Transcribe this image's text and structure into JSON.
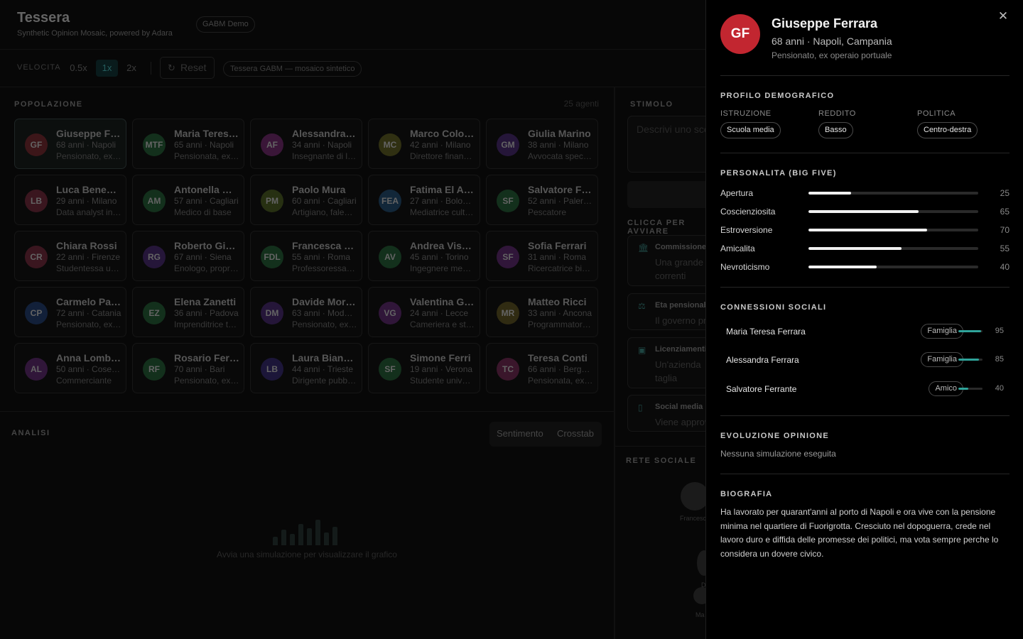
{
  "header": {
    "title": "Tessera",
    "subtitle": "Synthetic Opinion Mosaic, powered by Adara",
    "badge": "GABM Demo"
  },
  "toolbar": {
    "speed_label": "VELOCITA",
    "speeds": [
      "0.5x",
      "1x",
      "2x"
    ],
    "active_speed": "1x",
    "reset_icon": "refresh-icon",
    "reset_label": "Reset",
    "sim_badge": "Tessera GABM — mosaico sintetico"
  },
  "population": {
    "label": "POPOLAZIONE",
    "count": "25 agenti",
    "agents": [
      {
        "initials": "GF",
        "name": "Giuseppe Ferrara",
        "meta": "68 anni · Napoli",
        "job": "Pensionato, ex operaio portuale",
        "color": "#5c2327",
        "selected": true
      },
      {
        "initials": "MTF",
        "name": "Maria Teresa Ferrara",
        "meta": "65 anni · Napoli",
        "job": "Pensionata, ex insegnante",
        "color": "#1e4a2c"
      },
      {
        "initials": "AF",
        "name": "Alessandra Ferrara",
        "meta": "34 anni · Napoli",
        "job": "Insegnante di liceo",
        "color": "#5a2356"
      },
      {
        "initials": "MC",
        "name": "Marco Colombo",
        "meta": "42 anni · Milano",
        "job": "Direttore finanziario",
        "color": "#4a4a1c"
      },
      {
        "initials": "GM",
        "name": "Giulia Marino",
        "meta": "38 anni · Milano",
        "job": "Avvocata specializzata",
        "color": "#3a2358"
      },
      {
        "initials": "LB",
        "name": "Luca Benedetti",
        "meta": "29 anni · Milano",
        "job": "Data analyst in startup",
        "color": "#5a2330"
      },
      {
        "initials": "AM",
        "name": "Antonella Melis",
        "meta": "57 anni · Cagliari",
        "job": "Medico di base",
        "color": "#1e4a2c"
      },
      {
        "initials": "PM",
        "name": "Paolo Mura",
        "meta": "60 anni · Cagliari",
        "job": "Artigiano, falegname",
        "color": "#3c4a1c"
      },
      {
        "initials": "FEA",
        "name": "Fatima El Amrani",
        "meta": "27 anni · Bologna",
        "job": "Mediatrice culturale",
        "color": "#1c3c58"
      },
      {
        "initials": "SF",
        "name": "Salvatore Ferrante",
        "meta": "52 anni · Palermo",
        "job": "Pescatore",
        "color": "#1e4a2c"
      },
      {
        "initials": "CR",
        "name": "Chiara Rossi",
        "meta": "22 anni · Firenze",
        "job": "Studentessa universitaria",
        "color": "#5a2330"
      },
      {
        "initials": "RG",
        "name": "Roberto Giannini",
        "meta": "67 anni · Siena",
        "job": "Enologo, proprietario",
        "color": "#3a2358"
      },
      {
        "initials": "FDL",
        "name": "Francesca De Luca",
        "meta": "55 anni · Roma",
        "job": "Professoressa universitaria",
        "color": "#1e4a2c"
      },
      {
        "initials": "AV",
        "name": "Andrea Visconti",
        "meta": "45 anni · Torino",
        "job": "Ingegnere meccanico",
        "color": "#1e4a2c"
      },
      {
        "initials": "SF",
        "name": "Sofia Ferrari",
        "meta": "31 anni · Roma",
        "job": "Ricercatrice biomedica",
        "color": "#4a2358"
      },
      {
        "initials": "CP",
        "name": "Carmelo Pappalardo",
        "meta": "72 anni · Catania",
        "job": "Pensionato, ex agricoltore",
        "color": "#1c3258"
      },
      {
        "initials": "EZ",
        "name": "Elena Zanetti",
        "meta": "36 anni · Padova",
        "job": "Imprenditrice tessile",
        "color": "#1e4a2c"
      },
      {
        "initials": "DM",
        "name": "Davide Moretti",
        "meta": "63 anni · Modena",
        "job": "Pensionato, ex operaio",
        "color": "#3a2358"
      },
      {
        "initials": "VG",
        "name": "Valentina Greco",
        "meta": "24 anni · Lecce",
        "job": "Cameriera e studentessa",
        "color": "#4a2358"
      },
      {
        "initials": "MR",
        "name": "Matteo Ricci",
        "meta": "33 anni · Ancona",
        "job": "Programmatore freelance",
        "color": "#4a421c"
      },
      {
        "initials": "AL",
        "name": "Anna Lombardi",
        "meta": "50 anni · Cosenza",
        "job": "Commerciante",
        "color": "#4a2358"
      },
      {
        "initials": "RF",
        "name": "Rosario Ferraro",
        "meta": "70 anni · Bari",
        "job": "Pensionato, ex muratore",
        "color": "#1e4a2c"
      },
      {
        "initials": "LB",
        "name": "Laura Bianchi",
        "meta": "44 anni · Trieste",
        "job": "Dirigente pubblica",
        "color": "#2c2358"
      },
      {
        "initials": "SF",
        "name": "Simone Ferri",
        "meta": "19 anni · Verona",
        "job": "Studente universitario",
        "color": "#1e4a2c"
      },
      {
        "initials": "TC",
        "name": "Teresa Conti",
        "meta": "66 anni · Bergamo",
        "job": "Pensionata, ex sarta",
        "color": "#5a2342"
      }
    ]
  },
  "analysis": {
    "label": "ANALISI",
    "tabs": [
      "Sentimento",
      "Crosstab"
    ],
    "empty_icon": "bar-chart-icon",
    "empty_text": "Avvia una simulazione per visualizzare il grafico"
  },
  "stimulus": {
    "label": "STIMOLO",
    "placeholder": "Descrivi uno scenario",
    "scenarios_label": "CLICCA PER AVVIARE",
    "scenarios": [
      {
        "icon": "bank-icon",
        "title": "Commissione",
        "desc": "Una grande correnti"
      },
      {
        "icon": "scale-icon",
        "title": "Eta pensionabile",
        "desc": "Il governo propone"
      },
      {
        "icon": "briefcase-icon",
        "title": "Licenziamenti",
        "desc": "Un'azienda taglia intelligenza artificiale"
      },
      {
        "icon": "phone-icon",
        "title": "Social media",
        "desc": "Viene approvata"
      }
    ]
  },
  "network": {
    "label": "RETE SOCIALE",
    "node_labels": [
      "Francesca",
      "D",
      "Ma"
    ]
  },
  "detail": {
    "close_icon": "close-icon",
    "initials": "GF",
    "name": "Giuseppe Ferrara",
    "meta": "68 anni · Napoli, Campania",
    "job": "Pensionato, ex operaio portuale",
    "demo_title": "PROFILO DEMOGRAFICO",
    "demo": [
      {
        "label": "ISTRUZIONE",
        "value": "Scuola media"
      },
      {
        "label": "REDDITO",
        "value": "Basso"
      },
      {
        "label": "POLITICA",
        "value": "Centro-destra"
      }
    ],
    "personality_title": "PERSONALITA (BIG FIVE)",
    "traits": [
      {
        "name": "Apertura",
        "value": 25
      },
      {
        "name": "Coscienziosita",
        "value": 65
      },
      {
        "name": "Estroversione",
        "value": 70
      },
      {
        "name": "Amicalita",
        "value": 55
      },
      {
        "name": "Nevroticismo",
        "value": 40
      }
    ],
    "connections_title": "CONNESSIONI SOCIALI",
    "connections": [
      {
        "name": "Maria Teresa Ferrara",
        "relation": "Famiglia",
        "strength": 95
      },
      {
        "name": "Alessandra Ferrara",
        "relation": "Famiglia",
        "strength": 85
      },
      {
        "name": "Salvatore Ferrante",
        "relation": "Amico",
        "strength": 40
      }
    ],
    "evolution_title": "EVOLUZIONE OPINIONE",
    "evolution_text": "Nessuna simulazione eseguita",
    "bio_title": "BIOGRAFIA",
    "bio": "Ha lavorato per quarant'anni al porto di Napoli e ora vive con la pensione minima nel quartiere di Fuorigrotta. Cresciuto nel dopoguerra, crede nel lavoro duro e diffida delle promesse dei politici, ma vota sempre perche lo considera un dovere civico."
  }
}
